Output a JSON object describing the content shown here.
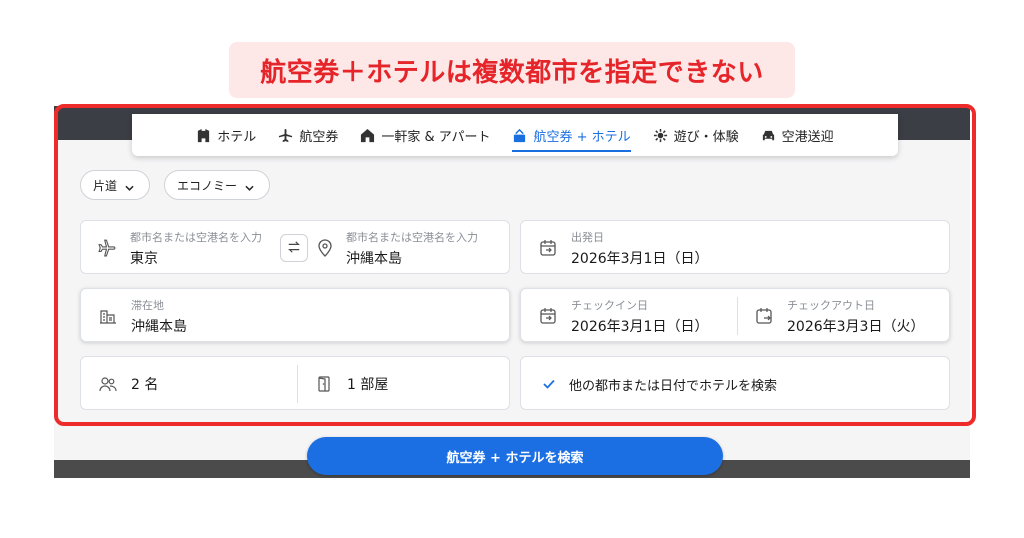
{
  "banner": {
    "text": "航空券＋ホテルは複数都市を指定できない"
  },
  "tabs": [
    {
      "label": "ホテル",
      "icon": "hotel-icon"
    },
    {
      "label": "航空券",
      "icon": "airplane-icon"
    },
    {
      "label": "一軒家 & アパート",
      "icon": "house-icon"
    },
    {
      "label": "航空券 + ホテル",
      "icon": "flight-hotel-icon",
      "active": true
    },
    {
      "label": "遊び・体験",
      "icon": "activities-icon"
    },
    {
      "label": "空港送迎",
      "icon": "car-icon"
    }
  ],
  "trip_type": {
    "value": "片道"
  },
  "cabin_class": {
    "value": "エコノミー"
  },
  "origin": {
    "placeholder": "都市名または空港名を入力",
    "value": "東京"
  },
  "destination": {
    "placeholder": "都市名または空港名を入力",
    "value": "沖縄本島"
  },
  "departure": {
    "label": "出発日",
    "value": "2026年3月1日（日）"
  },
  "stay": {
    "label": "滞在地",
    "value": "沖縄本島"
  },
  "checkin": {
    "label": "チェックイン日",
    "value": "2026年3月1日（日）"
  },
  "checkout": {
    "label": "チェックアウト日",
    "value": "2026年3月3日（火）"
  },
  "guests": {
    "value": "2 名"
  },
  "rooms": {
    "value": "1 部屋"
  },
  "other_option": {
    "label": "他の都市または日付でホテルを検索",
    "checked": true
  },
  "search_button": {
    "label": "航空券 + ホテルを検索"
  },
  "colors": {
    "accent": "#1c6fe3",
    "highlight": "#ee2b2b",
    "banner_text": "#e5252a",
    "banner_bg": "#fde7e7"
  }
}
